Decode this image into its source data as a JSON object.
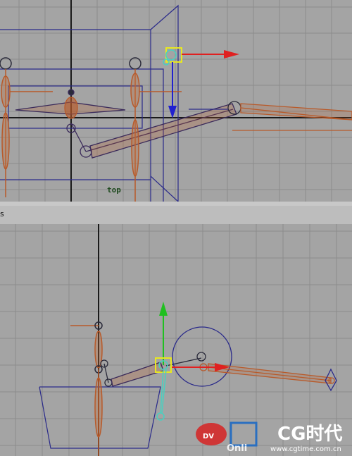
{
  "viewports": {
    "top": {
      "camera_label": "top"
    },
    "panel_bar": {
      "label": "s"
    },
    "persp": {}
  },
  "watermark": {
    "brand": "CG时代",
    "url": "www.cgtime.com.cn",
    "online": "Onli",
    "logo_left": "DV",
    "colors": {
      "logo_red": "#d42a2a",
      "logo_blue": "#2a6fc0"
    }
  },
  "colors": {
    "grid": "#8a8a8a",
    "axis": "#1a1a1a",
    "joint": "#b85a2a",
    "selection": "#2a2a8a",
    "control_cyan": "#4ad0c0",
    "manip_yellow": "#e8e820",
    "manip_red": "#e02020",
    "manip_green": "#20c020",
    "manip_blue": "#2020d0"
  }
}
